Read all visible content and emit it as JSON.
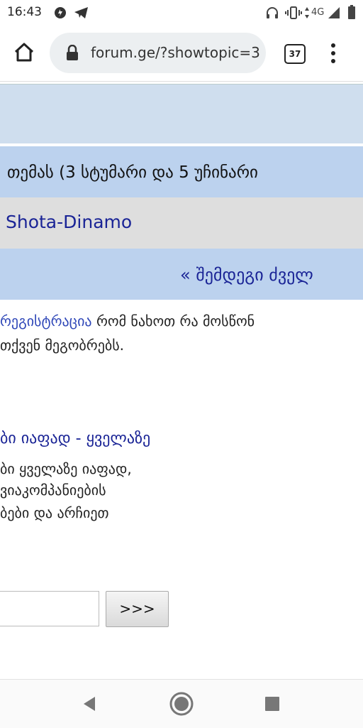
{
  "status_bar": {
    "time": "16:43",
    "network": "4G"
  },
  "browser": {
    "url": "forum.ge/?showtopic=3",
    "tab_count": "37"
  },
  "page": {
    "online_text": "თემას (3 სტუმარი და 5 უჩინარი",
    "user_link": "Shota-Dinamo",
    "pager_text": "« შემდეგი ძველ",
    "info": {
      "link": "რეგისტრაცია",
      "line1_rest": " რომ ნახოთ რა მოსწონ",
      "line2": "თქვენ მეგობრებს."
    },
    "ad": {
      "title": "ბი იაფად - ყველაზე",
      "lines": [
        "ბი ყველაზე იაფად,",
        "ვიაკომპანიების",
        "ბები და არჩიეთ"
      ]
    },
    "go_button": ">>>"
  }
}
